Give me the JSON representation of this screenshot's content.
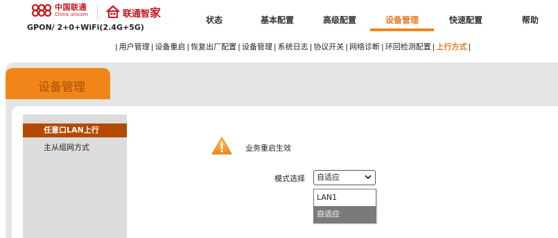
{
  "brand": {
    "name_cn": "中国联通",
    "name_en": "China unicom",
    "smart_home_prefix": "联通智",
    "smart_home_char": "家",
    "model": "GPON/ 2+0+WiFi(2.4G+5G)"
  },
  "nav": [
    {
      "label": "状态"
    },
    {
      "label": "基本配置"
    },
    {
      "label": "高级配置"
    },
    {
      "label": "设备管理"
    },
    {
      "label": "快速配置"
    },
    {
      "label": "帮助"
    }
  ],
  "subnav": {
    "items": [
      "用户管理",
      "设备重启",
      "恢复出厂配置",
      "设备管理",
      "系统日志",
      "协议开关",
      "网络诊断",
      "环回检测配置",
      "上行方式"
    ],
    "separator": "|"
  },
  "page_tab": "设备管理",
  "sidebar": [
    {
      "label": "任意口LAN上行"
    },
    {
      "label": "主从组网方式"
    }
  ],
  "content": {
    "message": "业务重启生效",
    "mode_label": "模式选择",
    "selected": "自适应",
    "options": [
      "LAN1",
      "自适应"
    ]
  },
  "colors": {
    "accent": "#f08619",
    "brand_red": "#c4161c",
    "sidebar_active": "#b34a00",
    "band_gray": "#e5e5e5"
  }
}
